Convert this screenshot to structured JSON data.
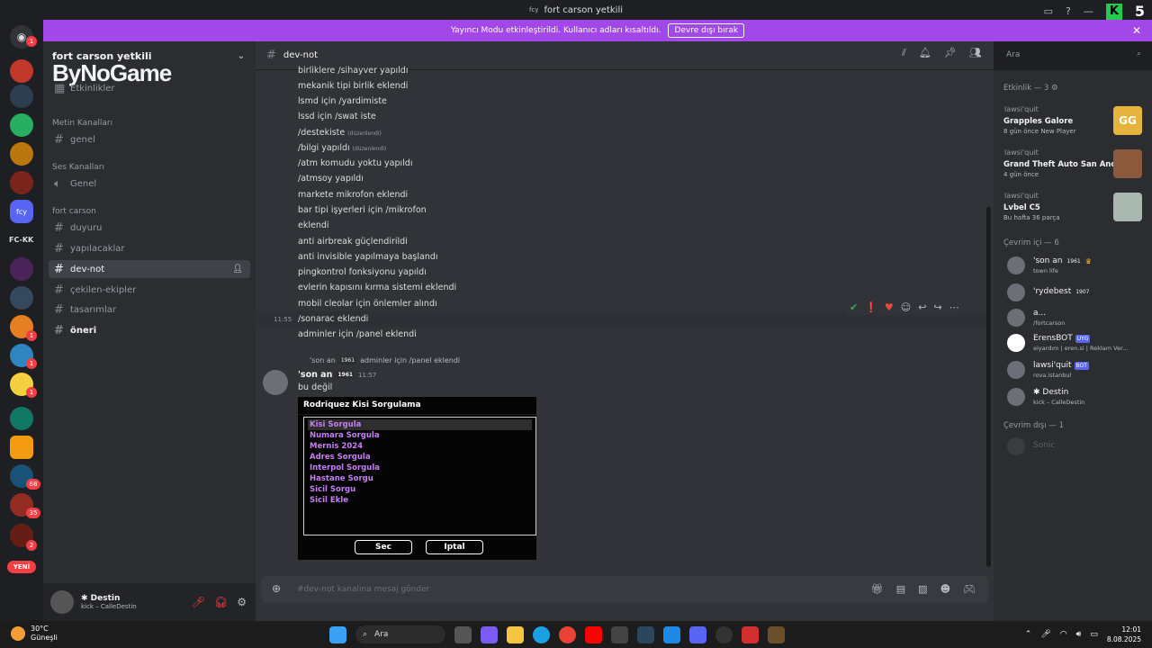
{
  "window": {
    "title": "fort carson yetkili",
    "title_prefix": "fcy",
    "overlay_count": "5"
  },
  "banner": {
    "text": "Yayıncı Modu etkinleştirildi. Kullanıcı adları kısaltıldı.",
    "button": "Devre dışı bırak"
  },
  "guild_rail": {
    "labels": [
      "fcy",
      "FC-KK",
      "YENİ"
    ],
    "badges": [
      "1",
      "1",
      "1",
      "1",
      "68",
      "35",
      "2"
    ]
  },
  "sidebar": {
    "server_name": "fort carson yetkili",
    "logo_text": "ByNoGame",
    "events_label": "Etkinlikler",
    "categories": {
      "text": "Metin Kanalları",
      "voice": "Ses Kanalları",
      "fc": "fort carson"
    },
    "channels": {
      "genel_text": "genel",
      "genel_voice": "Genel",
      "duyuru": "duyuru",
      "yapilacaklar": "yapılacaklar",
      "devnot": "dev-not",
      "cekilen": "çekilen-ekipler",
      "tasarimlar": "tasarımlar",
      "oneri": "öneri"
    },
    "user": {
      "name": "✱ Destin",
      "status": "kick – CalleDestin"
    }
  },
  "chat": {
    "channel": "dev-not",
    "search_placeholder": "Ara",
    "lines": [
      "birliklere /sihayver yapıldı",
      "mekanik tipi birlik eklendi",
      "lsmd için /yardimiste",
      "lssd için /swat iste",
      "/destekiste",
      "/bilgi yapıldı",
      "/atm komudu yoktu yapıldı",
      "/atmsoy yapıldı",
      "markete mikrofon eklendi",
      "bar tipi işyerleri için /mikrofon",
      "eklendi",
      "anti airbreak güçlendirildi",
      "anti invisible yapılmaya başlandı",
      "pingkontrol fonksiyonu yapıldı",
      "evlerin kapısını kırma sistemi eklendi",
      "mobil cleolar için önlemler alındı",
      "/sonarac eklendi",
      "adminler için /panel eklendi"
    ],
    "edited_label": "(düzenlendi)",
    "hover_time": "11:55",
    "reply": {
      "author": "'son an",
      "tag": "1961",
      "text": "adminler için /panel eklendi"
    },
    "message": {
      "author": "'son an",
      "tag": "1961",
      "time": "11:57",
      "text": "bu değil"
    },
    "composer_placeholder": "#dev-not kanalına mesaj gönder"
  },
  "dialog": {
    "title": "Rodriquez Kisi Sorgulama",
    "items": [
      "Kisi Sorgula",
      "Numara Sorgula",
      "Mernis 2024",
      "Adres Sorgula",
      "Interpol Sorgula",
      "Hastane Sorgu",
      "Sicil Sorgu",
      "Sicil Ekle"
    ],
    "selected_index": 0,
    "button_ok": "Sec",
    "button_cancel": "Iptal"
  },
  "activity": {
    "header": "Etkinlik — 3",
    "items": [
      {
        "user": "lawsi'quit",
        "title": "Grapples Galore",
        "sub": "8 gün önce   New Player"
      },
      {
        "user": "lawsi'quit",
        "title": "Grand Theft Auto San Andr...",
        "sub": "4 gün önce"
      },
      {
        "user": "lawsi'quit",
        "title": "Lvbel C5",
        "sub": "Bu hafta 36 parça"
      }
    ]
  },
  "members": {
    "online_header": "Çevrim içi — 6",
    "online": [
      {
        "name": "'son an",
        "tag": "1961",
        "sub": "town life"
      },
      {
        "name": "'rydebest",
        "tag": "1907",
        "sub": ""
      },
      {
        "name": "a...",
        "tag": "",
        "sub": "/fortcarson"
      },
      {
        "name": "ErensBOT",
        "tag": "UYG",
        "sub": "eiyardım | eren.si | Reklam Ver..."
      },
      {
        "name": "lawsi'quit",
        "tag": "BOT",
        "sub": "rova.istanbul"
      },
      {
        "name": "✱ Destin",
        "tag": "",
        "sub": "kick – CalleDestin"
      }
    ],
    "offline_header": "Çevrim dışı — 1",
    "offline": [
      {
        "name": "Sonic"
      }
    ]
  },
  "taskbar": {
    "temp": "30°C",
    "weather": "Güneşli",
    "search": "Ara",
    "time": "12:01",
    "date": "8.08.2025"
  },
  "colors": {
    "banner": "#a248e8",
    "dialog_item": "#c77df5",
    "accent": "#5865f2"
  }
}
